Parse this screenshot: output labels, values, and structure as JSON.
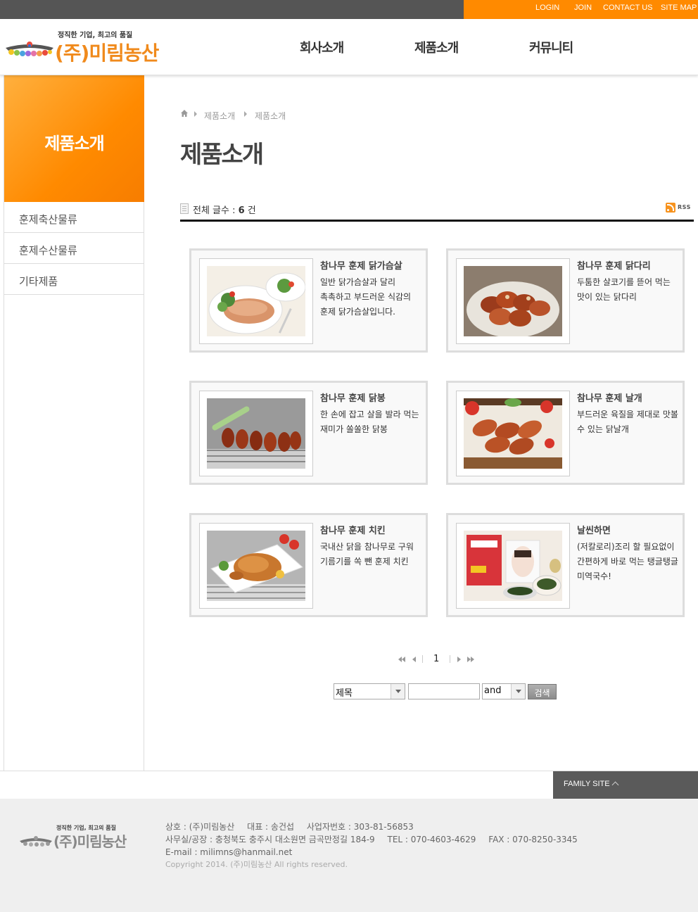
{
  "topbar": {
    "links": [
      {
        "label": "LOGIN"
      },
      {
        "label": "JOIN"
      },
      {
        "label": "CONTACT US"
      },
      {
        "label": "SITE MAP"
      }
    ]
  },
  "header": {
    "logo_tagline": "정직한 기업, 최고의 품질",
    "logo_name": "(주)미림농산",
    "nav": [
      "회사소개",
      "제품소개",
      "커뮤니티"
    ]
  },
  "sidebar": {
    "title": "제품소개",
    "items": [
      "훈제축산물류",
      "훈제수산물류",
      "기타제품"
    ]
  },
  "breadcrumb": [
    "제품소개",
    "제품소개"
  ],
  "page_title": "제품소개",
  "board": {
    "total_label": "전체 글수 : ",
    "total_count": "6",
    "total_unit": " 건",
    "rss_label": "RSS"
  },
  "products": [
    {
      "title": "참나무 훈제 닭가슴살",
      "desc": "일반 닭가슴살과 달리 촉촉하고 부드러운 식감의 훈제 닭가슴살입니다.",
      "image": "smoked-chicken-breast-photo"
    },
    {
      "title": "참나무 훈제 닭다리",
      "desc": "두툼한 살코기를 뜯어 먹는 맛이 있는 닭다리",
      "image": "smoked-chicken-leg-photo"
    },
    {
      "title": "참나무 훈제 닭봉",
      "desc": "한 손에 잡고 살을 발라 먹는 재미가 쏠쏠한 닭봉",
      "image": "smoked-drumette-photo"
    },
    {
      "title": "참나무 훈제 날개",
      "desc": "부드러운 육질을 제대로 맛볼 수 있는 닭날개",
      "image": "smoked-wing-photo"
    },
    {
      "title": "참나무 훈제 치킨",
      "desc": "국내산 닭을 참나무로 구워 기름기를 쏙 뺀 훈제 치킨",
      "image": "smoked-whole-chicken-photo"
    },
    {
      "title": "날씬하면",
      "desc": "(저칼로리)조리 할 필요없이 간편하게 바로 먹는 탱글탱글 미역국수!",
      "image": "seaweed-noodle-package-photo"
    }
  ],
  "pagination": {
    "current": "1"
  },
  "search": {
    "field_select": "제목",
    "keyword_value": "",
    "operator_select": "and",
    "button_label": "검색"
  },
  "footer": {
    "family_site": "FAMILY SITE",
    "logo_tagline": "정직한 기업, 최고의 품질",
    "logo_name": "(주)미림농산",
    "company": "상호 : (주)미림농산",
    "ceo": "대표 : 송건섭",
    "biz_no": "사업자번호 : 303-81-56853",
    "address": "사무실/공장 : 충청북도 충주시 대소원면 금곡만정길 184-9",
    "tel": "TEL : 070-4603-4629",
    "fax": "FAX : 070-8250-3345",
    "email": "E-mail : milimns@hanmail.net",
    "copyright": "Copyright 2014. (주)미림농산 All rights reserved."
  },
  "colors": {
    "accent": "#ff8a00",
    "topbar": "#555555",
    "logo": "#f08a1c",
    "card_border": "#dddddd"
  }
}
